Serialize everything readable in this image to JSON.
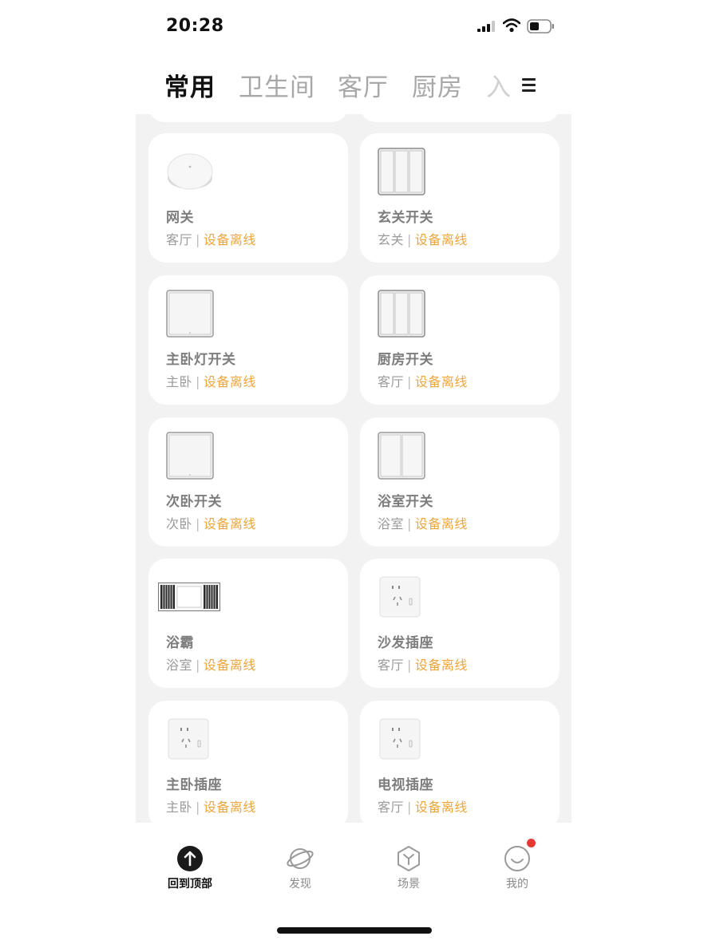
{
  "status": {
    "time": "20:28"
  },
  "tabs": {
    "items": [
      "常用",
      "卫生间",
      "客厅",
      "厨房"
    ],
    "overflow": "入"
  },
  "separator": "|",
  "devices": [
    {
      "name": "网关",
      "room": "客厅",
      "status": "设备离线",
      "icon": "gateway-icon"
    },
    {
      "name": "玄关开关",
      "room": "玄关",
      "status": "设备离线",
      "icon": "triple-switch-icon"
    },
    {
      "name": "主卧灯开关",
      "room": "主卧",
      "status": "设备离线",
      "icon": "single-switch-icon"
    },
    {
      "name": "厨房开关",
      "room": "客厅",
      "status": "设备离线",
      "icon": "triple-switch-icon"
    },
    {
      "name": "次卧开关",
      "room": "次卧",
      "status": "设备离线",
      "icon": "single-switch-icon"
    },
    {
      "name": "浴室开关",
      "room": "浴室",
      "status": "设备离线",
      "icon": "double-switch-icon"
    },
    {
      "name": "浴霸",
      "room": "浴室",
      "status": "设备离线",
      "icon": "bath-heater-icon"
    },
    {
      "name": "沙发插座",
      "room": "客厅",
      "status": "设备离线",
      "icon": "socket-icon"
    },
    {
      "name": "主卧插座",
      "room": "主卧",
      "status": "设备离线",
      "icon": "socket-icon"
    },
    {
      "name": "电视插座",
      "room": "客厅",
      "status": "设备离线",
      "icon": "socket-icon"
    }
  ],
  "tabbar": {
    "items": [
      {
        "label": "回到顶部",
        "icon": "arrow-up-circle-icon"
      },
      {
        "label": "发现",
        "icon": "planet-icon"
      },
      {
        "label": "场景",
        "icon": "hexagon-scene-icon"
      },
      {
        "label": "我的",
        "icon": "smile-face-icon"
      }
    ]
  },
  "colors": {
    "offline": "#efa53a",
    "badge": "#e53935",
    "background": "#f2f2f2"
  }
}
